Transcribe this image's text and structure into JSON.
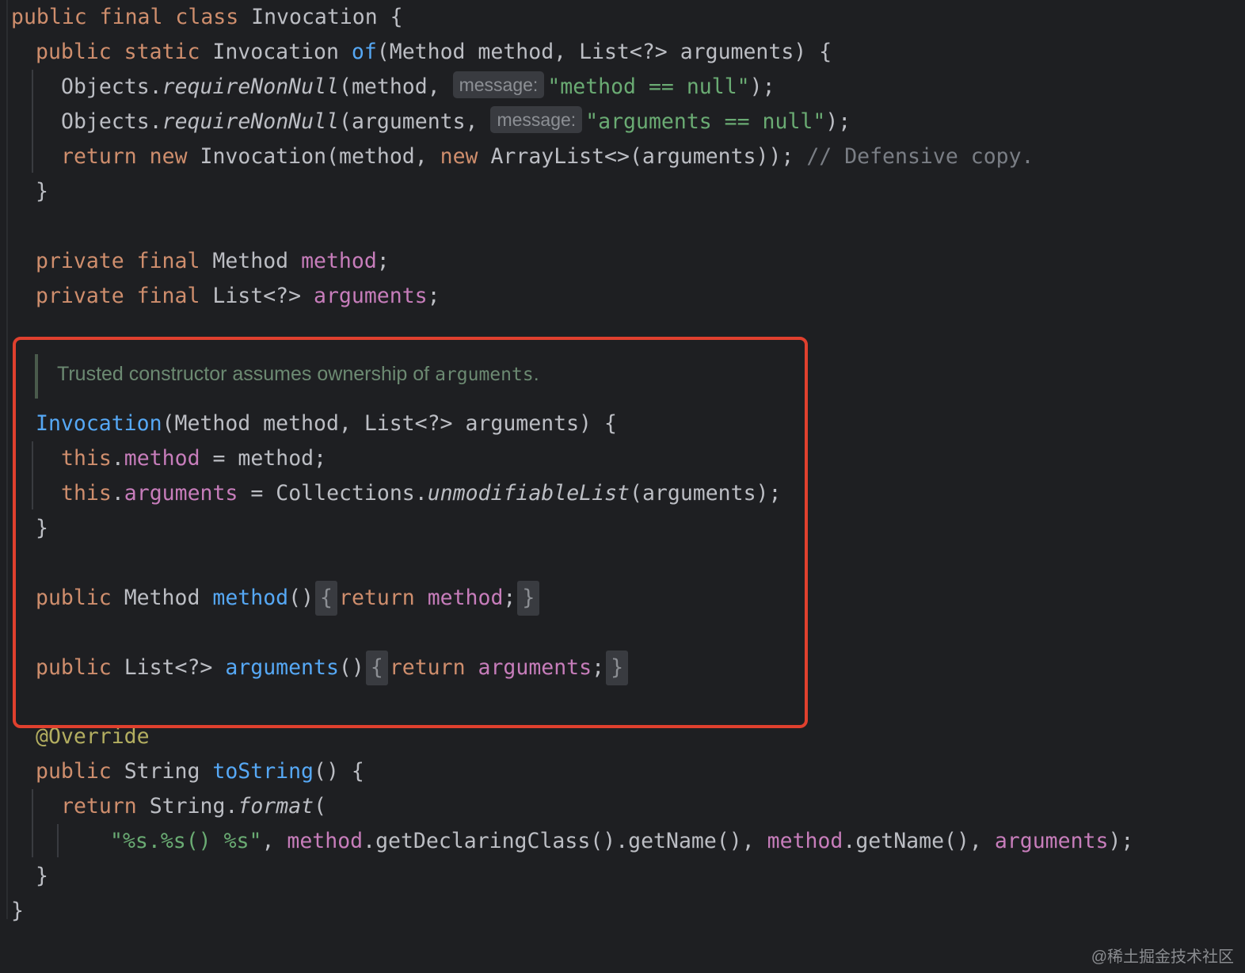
{
  "code": {
    "class_decl": {
      "kw": "public final class ",
      "name": "Invocation",
      "rest": " {"
    },
    "factory": {
      "kw": "public static ",
      "type": "Invocation ",
      "name": "of",
      "params": "(Method method, List<?> arguments) {",
      "line1_pre": "Objects.",
      "line1_call": "requireNonNull",
      "line1_args": "(method, ",
      "line1_hint": "message:",
      "line1_str": "\"method == null\"",
      "line1_end": ");",
      "line2_pre": "Objects.",
      "line2_call": "requireNonNull",
      "line2_args": "(arguments, ",
      "line2_hint": "message:",
      "line2_str": "\"arguments == null\"",
      "line2_end": ");",
      "line3_kw": "return new ",
      "line3_mid": "Invocation(method, ",
      "line3_kw2": "new ",
      "line3_rest": "ArrayList<>(arguments)); ",
      "line3_comment": "// Defensive copy.",
      "close": "}"
    },
    "fields": {
      "f1_kw": "private final ",
      "f1_type": "Method ",
      "f1_name": "method",
      "f1_end": ";",
      "f2_kw": "private final ",
      "f2_type": "List<?> ",
      "f2_name": "arguments",
      "f2_end": ";"
    },
    "doc_comment": {
      "text": "Trusted constructor assumes ownership of ",
      "code": "arguments",
      "end": "."
    },
    "constructor": {
      "name": "Invocation",
      "params": "(Method method, List<?> arguments) {",
      "l1_kw": "this",
      "l1_dot": ".",
      "l1_field": "method",
      "l1_rest": " = method;",
      "l2_kw": "this",
      "l2_dot": ".",
      "l2_field": "arguments",
      "l2_mid": " = Collections.",
      "l2_call": "unmodifiableList",
      "l2_rest": "(arguments);",
      "close": "}"
    },
    "getter_method": {
      "kw": "public ",
      "type": "Method ",
      "name": "method",
      "parens": "()",
      "fold_open": "{",
      "ret_kw": "return ",
      "ret_field": "method",
      "semi": ";",
      "fold_close": "}"
    },
    "getter_arguments": {
      "kw": "public ",
      "type": "List<?> ",
      "name": "arguments",
      "parens": "()",
      "fold_open": "{",
      "ret_kw": "return ",
      "ret_field": "arguments",
      "semi": ";",
      "fold_close": "}"
    },
    "to_string": {
      "annotation": "@Override",
      "kw": "public ",
      "type": "String ",
      "name": "toString",
      "rest": "() {",
      "ret_kw": "return ",
      "ret_mid": "String.",
      "ret_call": "format",
      "ret_open": "(",
      "fmt_str": "\"%s.%s() %s\"",
      "a1": ", ",
      "a1_field": "method",
      "a1_rest": ".getDeclaringClass().getName(), ",
      "a2_field": "method",
      "a2_rest": ".getName(), ",
      "a3_field": "arguments",
      "a3_end": ");",
      "close": "}"
    },
    "class_close": "}"
  },
  "watermark": "@稀土掘金技术社区",
  "colors": {
    "background": "#1e1f22",
    "keyword": "#cf8e6d",
    "function": "#56a8f5",
    "field": "#c77dbb",
    "string": "#6aab73",
    "comment": "#7a7e85",
    "annotation": "#b3ae60",
    "highlight_border": "#e0402e"
  }
}
